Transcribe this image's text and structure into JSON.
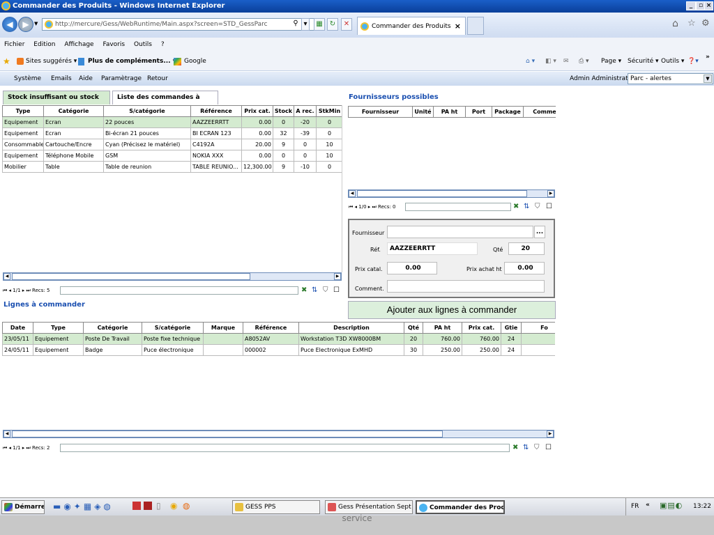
{
  "window": {
    "title": "Commander des Produits - Windows Internet Explorer"
  },
  "browser": {
    "url": "http://mercure/Gess/WebRuntime/Main.aspx?screen=STD_GessParc",
    "tab_label": "Commander des Produits",
    "menu": [
      "Fichier",
      "Edition",
      "Affichage",
      "Favoris",
      "Outils",
      "?"
    ],
    "favorites": {
      "suggested": "Sites suggérés ▾",
      "more": "Plus de compléments... ▾",
      "google": "Google"
    },
    "toolbar_right": {
      "page": "Page ▾",
      "security": "Sécurité ▾",
      "tools": "Outils ▾"
    }
  },
  "app": {
    "menu": [
      "Système",
      "Emails",
      "Aide",
      "Paramètrage",
      "Retour"
    ],
    "user": "Admin Administrator",
    "context_select": "Parc - alertes"
  },
  "stock": {
    "tabs": [
      "Stock insuffisant ou stock mini",
      "Liste des commandes à établir"
    ],
    "columns": [
      "Type",
      "Catégorie",
      "S/catégorie",
      "Référence",
      "Prix cat.",
      "Stock",
      "A rec.",
      "StkMin"
    ],
    "rows": [
      [
        "Equipement",
        "Ecran",
        "22 pouces",
        "AAZZEERRTT",
        "0.00",
        "0",
        "-20",
        "0"
      ],
      [
        "Equipement",
        "Ecran",
        "Bi-écran 21 pouces",
        "BI ECRAN 123",
        "0.00",
        "32",
        "-39",
        "0"
      ],
      [
        "Consommable",
        "Cartouche/Encre",
        "Cyan (Précisez le matériel)",
        "C4192A",
        "20.00",
        "9",
        "0",
        "10"
      ],
      [
        "Equipement",
        "Téléphone Mobile",
        "GSM",
        "NOKIA XXX",
        "0.00",
        "0",
        "0",
        "10"
      ],
      [
        "Mobilier",
        "Table",
        "Table de reunion",
        "TABLE REUNIO...",
        "12,300.00",
        "9",
        "-10",
        "0"
      ]
    ],
    "pager": "1/1",
    "recs": "Recs: 5"
  },
  "suppliers": {
    "title": "Fournisseurs possibles",
    "columns": [
      "Fournisseur",
      "Unité",
      "PA ht",
      "Port",
      "Package",
      "Comme"
    ],
    "pager": "1/0",
    "recs": "Recs: 0"
  },
  "form": {
    "supplier_label": "Fournisseur",
    "supplier_value": "",
    "ref_label": "Réf.",
    "ref_value": "AAZZEERRTT",
    "qty_label": "Qté",
    "qty_value": "20",
    "price_cat_label": "Prix catal.",
    "price_cat_value": "0.00",
    "price_buy_label": "Prix achat ht",
    "price_buy_value": "0.00",
    "comment_label": "Comment.",
    "comment_value": "",
    "browse_btn": "..."
  },
  "add_button": "Ajouter aux lignes à commander",
  "orders": {
    "title": "Lignes à commander",
    "columns": [
      "Date",
      "Type",
      "Catégorie",
      "S/catégorie",
      "Marque",
      "Référence",
      "Description",
      "Qté",
      "PA ht",
      "Prix cat.",
      "Gtie",
      "Fo"
    ],
    "rows": [
      [
        "23/05/11",
        "Equipement",
        "Poste De Travail",
        "Poste fixe technique",
        "",
        "A8052AV",
        "Workstation T3D XW8000BM",
        "20",
        "760.00",
        "760.00",
        "24",
        ""
      ],
      [
        "24/05/11",
        "Equipement",
        "Badge",
        "Puce électronique",
        "",
        "000002",
        "Puce Electronique ExMHD",
        "30",
        "250.00",
        "250.00",
        "24",
        ""
      ]
    ],
    "pager": "1/1",
    "recs": "Recs: 2"
  },
  "taskbar": {
    "start": "Démarrer",
    "items": [
      "GESS PPS",
      "Gess Présentation Sept ...",
      "Commander des Prod..."
    ],
    "lang": "FR",
    "clock": "13:22"
  },
  "footer_text": "service",
  "colors": {
    "highlight": "#d4ebd0",
    "title_blue": "#1a4fb0",
    "titlebar": "#0a3f9a"
  }
}
